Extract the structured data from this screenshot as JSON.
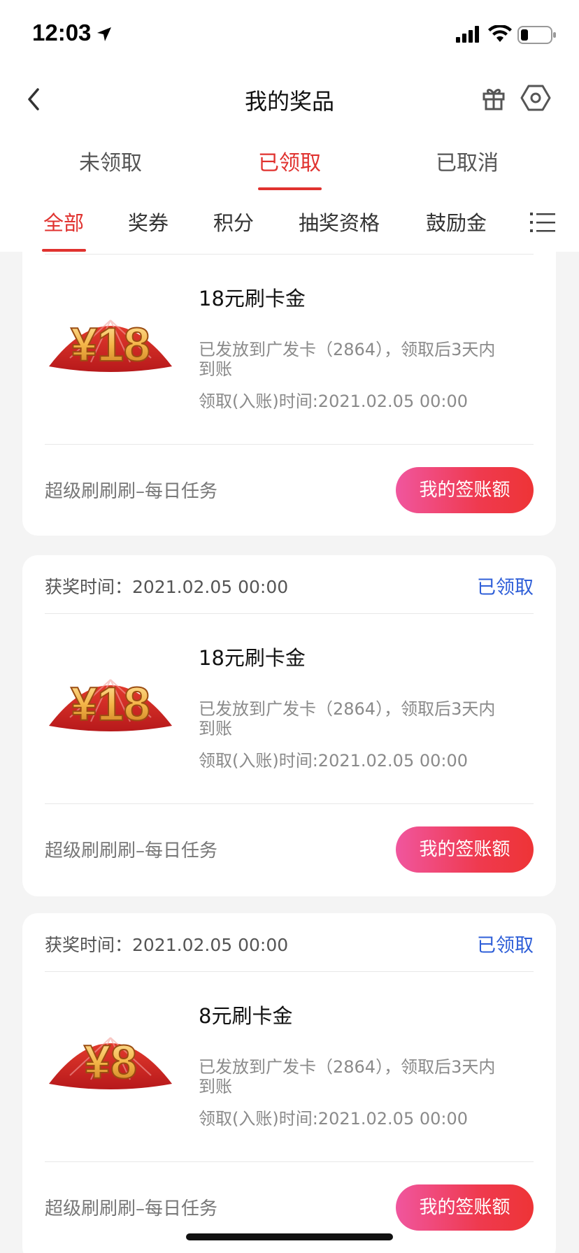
{
  "status_bar": {
    "time": "12:03"
  },
  "nav": {
    "title": "我的奖品"
  },
  "main_tabs": [
    {
      "label": "未领取"
    },
    {
      "label": "已领取"
    },
    {
      "label": "已取消"
    }
  ],
  "sub_tabs": [
    {
      "label": "全部"
    },
    {
      "label": "奖券"
    },
    {
      "label": "积分"
    },
    {
      "label": "抽奖资格"
    },
    {
      "label": "鼓励金"
    }
  ],
  "cards": [
    {
      "coupon_amount": "¥18",
      "prize_name": "18元刷卡金",
      "desc": "已发放到广发卡（2864），领取后3天内到账",
      "claim_time": "领取(入账)时间:2021.02.05 00:00",
      "source": "超级刷刷刷–每日任务",
      "button": "我的签账额"
    },
    {
      "win_time": "获奖时间：2021.02.05 00:00",
      "status": "已领取",
      "coupon_amount": "¥18",
      "prize_name": "18元刷卡金",
      "desc": "已发放到广发卡（2864），领取后3天内到账",
      "claim_time": "领取(入账)时间:2021.02.05 00:00",
      "source": "超级刷刷刷–每日任务",
      "button": "我的签账额"
    },
    {
      "win_time": "获奖时间：2021.02.05 00:00",
      "status": "已领取",
      "coupon_amount": "¥8",
      "prize_name": "8元刷卡金",
      "desc": "已发放到广发卡（2864），领取后3天内到账",
      "claim_time": "领取(入账)时间:2021.02.05 00:00",
      "source": "超级刷刷刷–每日任务",
      "button": "我的签账额"
    }
  ],
  "colors": {
    "accent_red": "#e0322f",
    "status_blue": "#2f5fd8",
    "button_gradient": [
      "#f0569e",
      "#ee3436"
    ]
  },
  "icons": [
    "location-arrow-icon",
    "signal-icon",
    "wifi-icon",
    "battery-icon",
    "back-icon",
    "gift-icon",
    "hexagon-settings-icon",
    "list-icon"
  ]
}
